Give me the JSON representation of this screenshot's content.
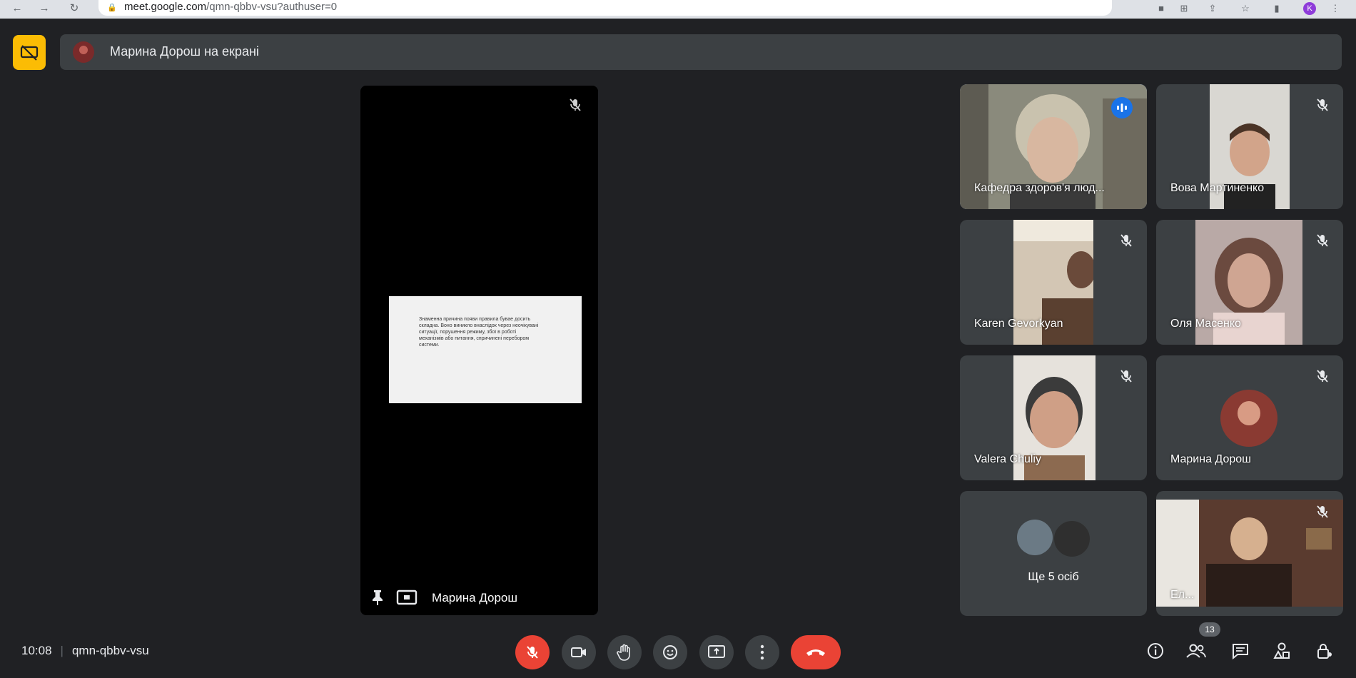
{
  "browser": {
    "url_domain": "meet.google.com",
    "url_rest": "/qmn-qbbv-vsu?authuser=0",
    "profile_initial": "K"
  },
  "banner": {
    "text": "Марина Дорош на екрані"
  },
  "presentation": {
    "presenter_name": "Марина Дорош",
    "doc_text": "Знаменна причина появи правила бувае досить складна. Воно виникло внаслідок через неочікувані ситуації, порушення режиму, збої в роботі механізмів або питання, спричинені перебором системи."
  },
  "participants": [
    {
      "name": "Кафедра здоров'я люд...",
      "speaking": true
    },
    {
      "name": "Вова Мартиненко"
    },
    {
      "name": "Karen Gevorkyan"
    },
    {
      "name": "Оля Масенко"
    },
    {
      "name": "Valera Chuliy"
    },
    {
      "name": "Марина Дорош"
    },
    {
      "name": "Ще 5 осіб"
    },
    {
      "name": "Ел..."
    }
  ],
  "meeting": {
    "time": "10:08",
    "code": "qmn-qbbv-vsu",
    "participant_count": "13"
  },
  "colors": {
    "background": "#202124",
    "tile": "#3c4043",
    "accent_yellow": "#fbbc04",
    "danger_red": "#ea4335",
    "speaking_blue": "#1a73e8"
  }
}
